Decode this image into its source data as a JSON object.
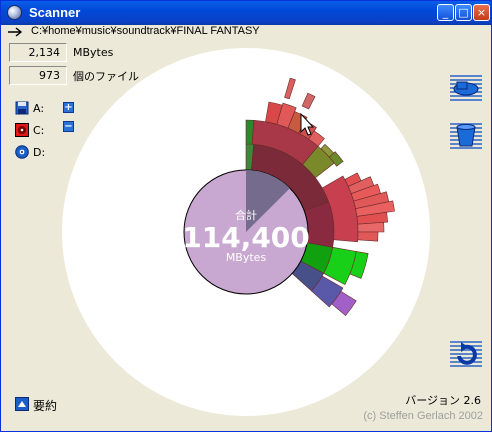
{
  "window": {
    "title": "Scanner",
    "controls": {
      "minimize": "_",
      "maximize": "□",
      "close": "×"
    }
  },
  "path": "C:¥home¥music¥soundtrack¥FINAL FANTASY",
  "stats": {
    "size_value": "2,134",
    "size_unit": "MBytes",
    "file_count": "973",
    "file_label": "個のファイル"
  },
  "drives": [
    {
      "label": "A:",
      "icon": "floppy-disk-icon"
    },
    {
      "label": "C:",
      "icon": "hard-disk-icon"
    },
    {
      "label": "D:",
      "icon": "cd-drive-icon"
    }
  ],
  "zoom": {
    "in_label": "+",
    "out_label": "−"
  },
  "chart": {
    "total_label": "合計",
    "total_value": "114,400",
    "total_unit": "MBytes",
    "highlighted_fraction": 0.019
  },
  "right_buttons": [
    "open-icon",
    "trash-icon",
    "refresh-icon"
  ],
  "footer": {
    "summary_label": "要約",
    "version": "バージョン 2.6",
    "copyright": "(c) Steffen Gerlach 2002"
  },
  "colors": {
    "titlebar": "#0a5ee8",
    "pie_fill": "#c8a8d0",
    "pie_highlight": "#756c8d",
    "ring_red": "#e05858",
    "ring_green": "#18d018",
    "ring_olive": "#8a9a3a"
  }
}
